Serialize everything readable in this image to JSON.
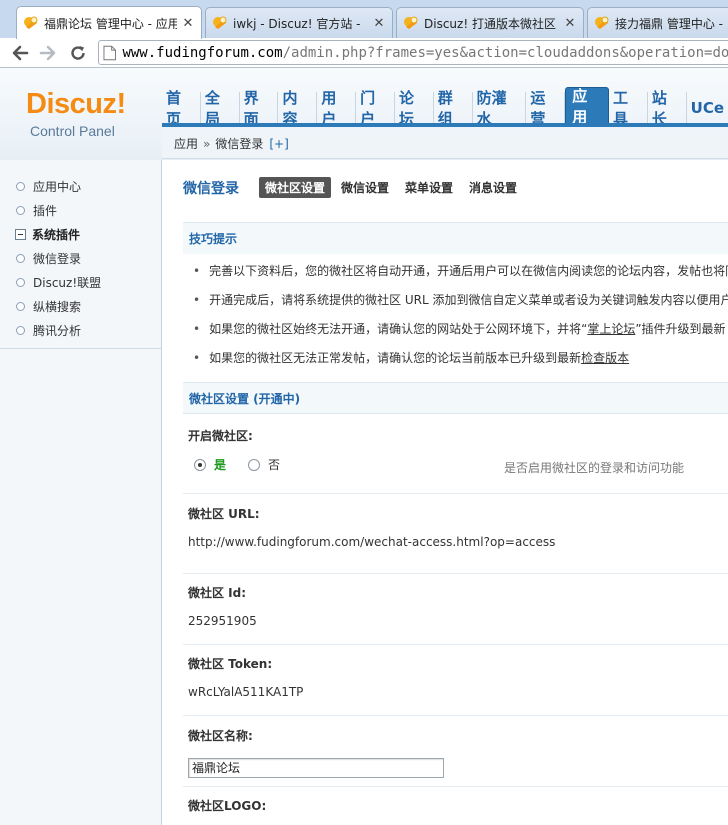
{
  "browser": {
    "tabs": [
      {
        "title": "福鼎论坛 管理中心 - 应用",
        "active": true
      },
      {
        "title": "iwkj - Discuz! 官方站 -",
        "active": false
      },
      {
        "title": "Discuz! 打通版本微社区",
        "active": false
      },
      {
        "title": "接力福鼎 管理中心 -",
        "active": false
      }
    ],
    "url_host": "www.fudingforum.com",
    "url_path": "/admin.php?frames=yes&action=cloudaddons&operation=downlo"
  },
  "header": {
    "logo_text": "Discuz!",
    "logo_sub": "Control Panel",
    "nav": [
      "首页",
      "全局",
      "界面",
      "内容",
      "用户",
      "门户",
      "论坛",
      "群组",
      "防灌水",
      "运营",
      "应用",
      "工具",
      "站长",
      "UCe"
    ],
    "active_nav": "应用",
    "breadcrumb": {
      "root": "应用",
      "sep": "»",
      "current": "微信登录",
      "add": "[+]"
    }
  },
  "sidebar": {
    "items": [
      {
        "label": "应用中心",
        "type": "item"
      },
      {
        "label": "插件",
        "type": "item"
      },
      {
        "label": "系统插件",
        "type": "group"
      },
      {
        "label": "微信登录",
        "type": "item"
      },
      {
        "label": "Discuz!联盟",
        "type": "item"
      },
      {
        "label": "纵横搜索",
        "type": "item"
      },
      {
        "label": "腾讯分析",
        "type": "item"
      }
    ]
  },
  "main": {
    "plugin_title": "微信登录",
    "subtabs": [
      "微社区设置",
      "微信设置",
      "菜单设置",
      "消息设置"
    ],
    "active_subtab": "微社区设置",
    "tips_title": "技巧提示",
    "tips": [
      {
        "text": "完善以下资料后，您的微社区将自动开通，开通后用户可以在微信内阅读您的论坛内容，发帖也将同步",
        "link": "",
        "after": ""
      },
      {
        "text": "开通完成后，请将系统提供的微社区 URL 添加到微信自定义菜单或者设为关键词触发内容以便用户访问",
        "link": "",
        "after": ""
      },
      {
        "text": "如果您的微社区始终无法开通，请确认您的网站处于公网环境下，并将“",
        "link": "掌上论坛",
        "after": "”插件升级到最新"
      },
      {
        "text": "如果您的微社区无法正常发帖，请确认您的论坛当前版本已升级到最新 ",
        "link": "检查版本",
        "after": ""
      }
    ],
    "settings_title": "微社区设置 (开通中)",
    "enable_label": "开启微社区:",
    "radio_yes": "是",
    "radio_no": "否",
    "enable_hint": "是否启用微社区的登录和访问功能",
    "url_label": "微社区 URL:",
    "url_value": "http://www.fudingforum.com/wechat-access.html?op=access",
    "id_label": "微社区 Id:",
    "id_value": "252951905",
    "token_label": "微社区 Token:",
    "token_value": "wRcLYalA511KA1TP",
    "name_label": "微社区名称:",
    "name_value": "福鼎论坛",
    "logo_label": "微社区LOGO:"
  },
  "colors": {
    "accent": "#2366a8",
    "logo_orange": "#f58b13",
    "nav_active_bg": "#2d7ab9",
    "yes_green": "#199a1b"
  }
}
